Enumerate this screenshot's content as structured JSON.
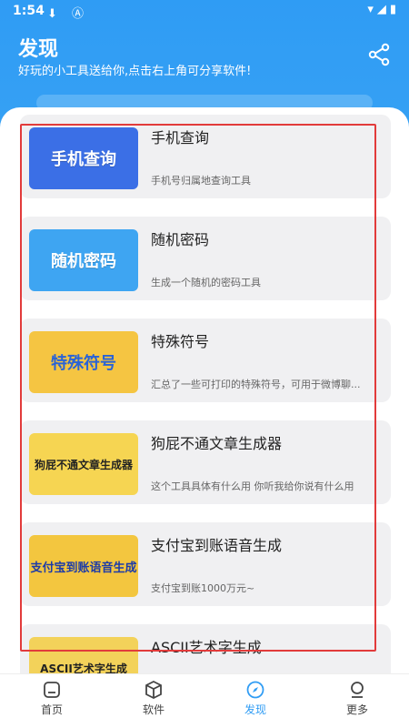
{
  "status_bar": {
    "time": "1:54"
  },
  "header": {
    "title": "发现",
    "subtitle": "好玩的小工具送给你,点击右上角可分享软件!"
  },
  "items": [
    {
      "name": "手机查询",
      "desc": "手机号归属地查询工具",
      "thumb_text": "手机查询",
      "thumb_color": "#3b6fe6"
    },
    {
      "name": "随机密码",
      "desc": "生成一个随机的密码工具",
      "thumb_text": "随机密码",
      "thumb_color": "#3ea5f2"
    },
    {
      "name": "特殊符号",
      "desc": "汇总了一些可打印的特殊符号，可用于微博聊...",
      "thumb_text": "特殊符号",
      "thumb_color": "#f5c542"
    },
    {
      "name": "狗屁不通文章生成器",
      "desc": "这个工具具体有什么用 你听我给你说有什么用",
      "thumb_text": "狗屁不通文章生成器",
      "thumb_color": "#f6d552"
    },
    {
      "name": "支付宝到账语音生成",
      "desc": "支付宝到账1000万元~",
      "thumb_text": "支付宝到账语音生成",
      "thumb_color": "#f3c63f"
    },
    {
      "name": "ASCII艺术字生成",
      "desc": "",
      "thumb_text": "ASCII艺术字生成",
      "thumb_color": "#f3d25a"
    }
  ],
  "tabs": [
    {
      "label": "首页",
      "icon": "home-icon"
    },
    {
      "label": "软件",
      "icon": "package-icon"
    },
    {
      "label": "发现",
      "icon": "compass-icon"
    },
    {
      "label": "更多",
      "icon": "user-icon"
    }
  ],
  "colors": {
    "primary": "#2f9cf4",
    "highlight": "#e23b3b"
  }
}
